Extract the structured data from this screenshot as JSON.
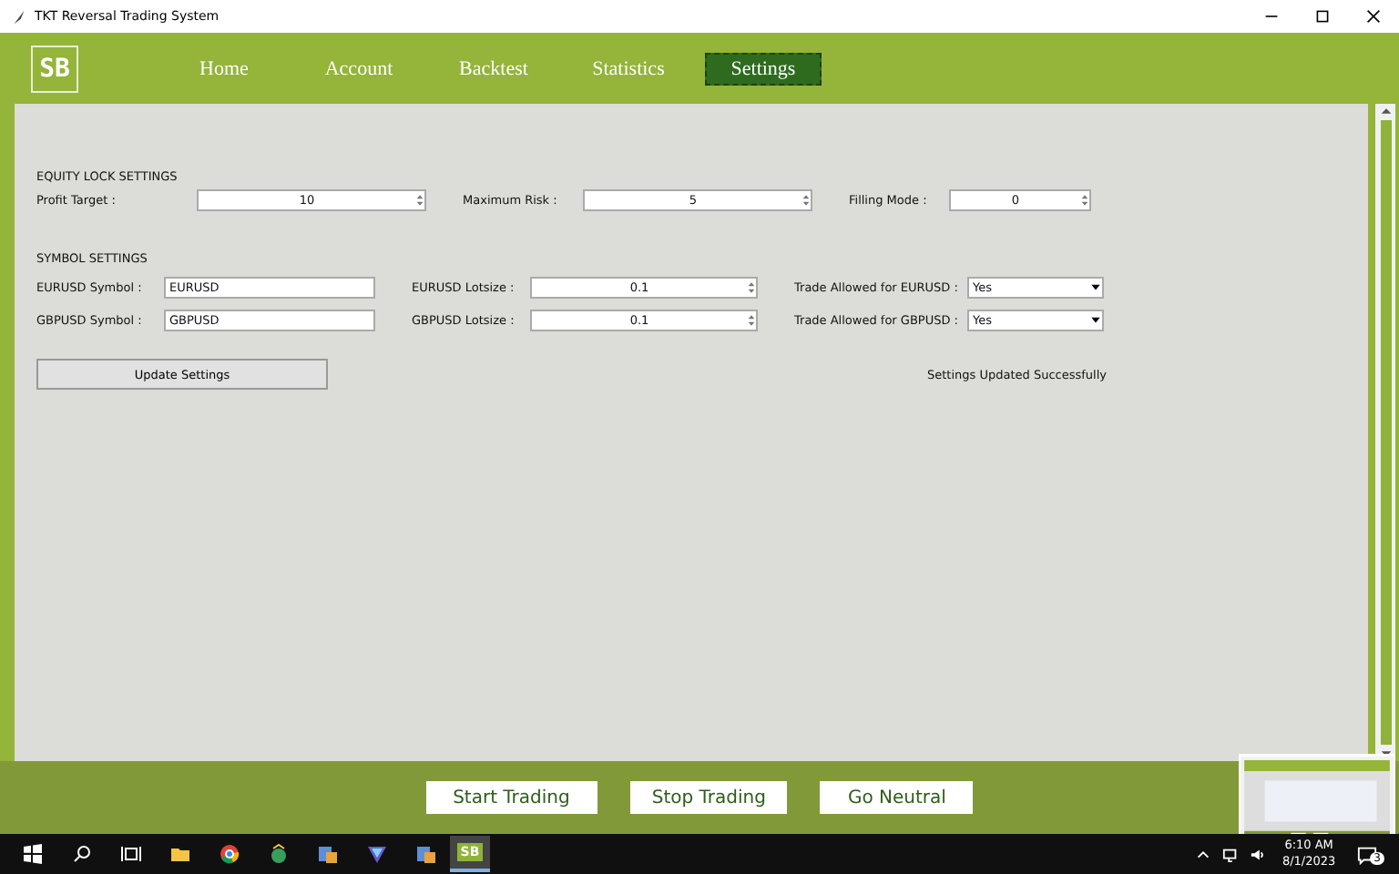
{
  "window": {
    "title": "TKT Reversal Trading System"
  },
  "logo": {
    "text": "SB"
  },
  "tabs": [
    {
      "label": "Home",
      "selected": false
    },
    {
      "label": "Account",
      "selected": false
    },
    {
      "label": "Backtest",
      "selected": false
    },
    {
      "label": "Statistics",
      "selected": false
    },
    {
      "label": "Settings",
      "selected": true
    }
  ],
  "equity_lock": {
    "heading": "EQUITY LOCK SETTINGS",
    "fields": [
      {
        "label": "Profit Target :",
        "value": "10",
        "kind": "spinbox"
      },
      {
        "label": "Maximum Risk :",
        "value": "5",
        "kind": "spinbox"
      },
      {
        "label": "Filling Mode :",
        "value": "0",
        "kind": "spinbox"
      }
    ]
  },
  "symbol_settings": {
    "heading": "SYMBOL SETTINGS",
    "rows": [
      [
        {
          "label": "EURUSD Symbol :",
          "value": "EURUSD",
          "kind": "text"
        },
        {
          "label": "EURUSD Lotsize :",
          "value": "0.1",
          "kind": "spinbox"
        },
        {
          "label": "Trade Allowed for EURUSD :",
          "value": "Yes",
          "kind": "combo"
        }
      ],
      [
        {
          "label": "GBPUSD Symbol :",
          "value": "GBPUSD",
          "kind": "text"
        },
        {
          "label": "GBPUSD Lotsize :",
          "value": "0.1",
          "kind": "spinbox"
        },
        {
          "label": "Trade Allowed for GBPUSD :",
          "value": "Yes",
          "kind": "combo"
        }
      ]
    ]
  },
  "update_button": "Update Settings",
  "status_message": "Settings Updated Successfully",
  "footer_buttons": [
    "Start Trading",
    "Stop Trading",
    "Go Neutral"
  ],
  "taskbar": {
    "active_app": "SB",
    "time": "6:10 AM",
    "date": "8/1/2023",
    "notifications": "3"
  }
}
